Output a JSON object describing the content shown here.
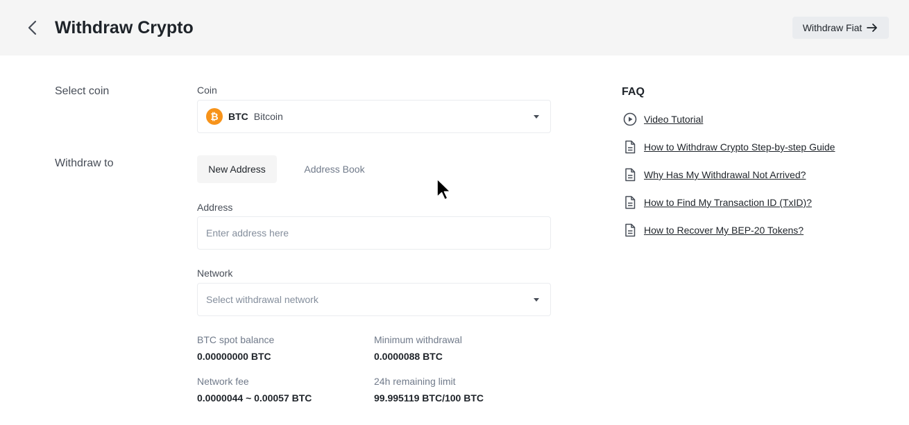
{
  "header": {
    "title": "Withdraw Crypto",
    "withdraw_fiat_label": "Withdraw Fiat"
  },
  "coin_section": {
    "section_label": "Select coin",
    "field_label": "Coin",
    "selected_symbol": "BTC",
    "selected_name": "Bitcoin",
    "coin_icon_glyph": "₿",
    "coin_color": "#f7931a"
  },
  "withdraw_section": {
    "section_label": "Withdraw to",
    "tabs": [
      "New Address",
      "Address Book"
    ],
    "address_label": "Address",
    "address_placeholder": "Enter address here",
    "network_label": "Network",
    "network_placeholder": "Select withdrawal network"
  },
  "balances": {
    "spot_balance_label": "BTC spot balance",
    "spot_balance_value": "0.00000000 BTC",
    "min_withdrawal_label": "Minimum withdrawal",
    "min_withdrawal_value": "0.0000088 BTC",
    "network_fee_label": "Network fee",
    "network_fee_value": "0.0000044 ~ 0.00057 BTC",
    "remaining_limit_label": "24h remaining limit",
    "remaining_limit_value": "99.995119 BTC/100 BTC"
  },
  "faq": {
    "title": "FAQ",
    "items": [
      {
        "label": "Video Tutorial",
        "icon": "play-circle-icon"
      },
      {
        "label": "How to Withdraw Crypto Step-by-step Guide",
        "icon": "document-icon"
      },
      {
        "label": "Why Has My Withdrawal Not Arrived?",
        "icon": "document-icon"
      },
      {
        "label": "How to Find My Transaction ID (TxID)?",
        "icon": "document-icon"
      },
      {
        "label": "How to Recover My BEP-20 Tokens?",
        "icon": "document-icon"
      }
    ]
  }
}
